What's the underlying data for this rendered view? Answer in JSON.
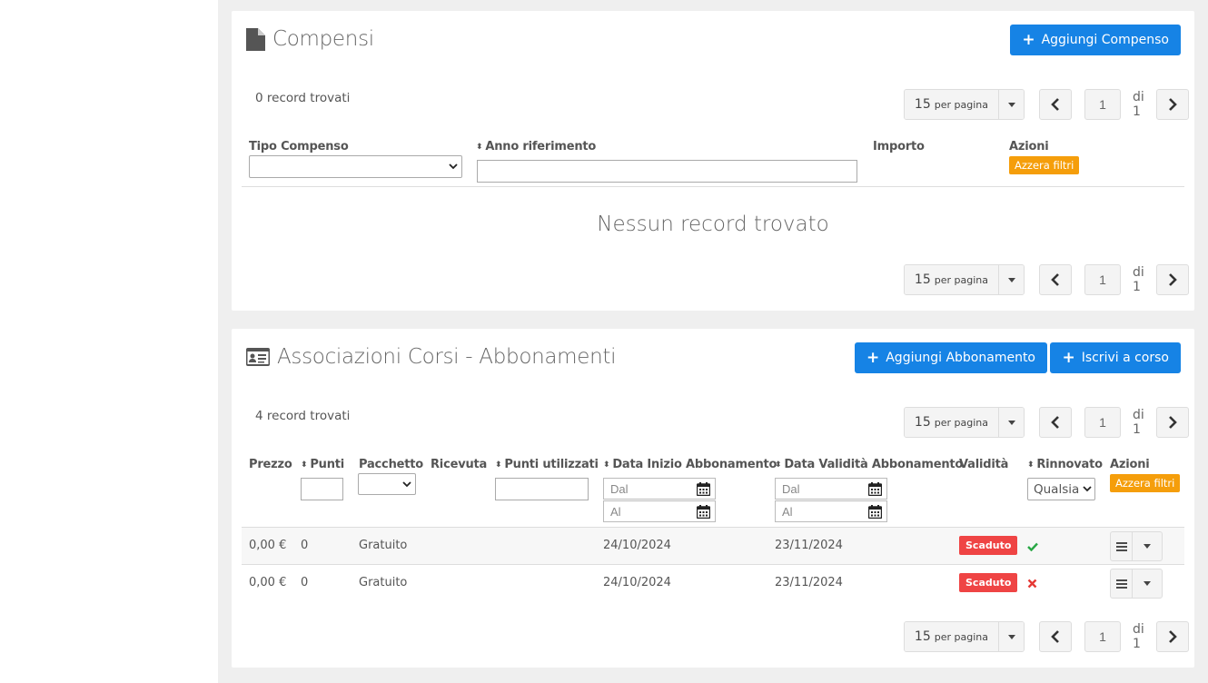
{
  "compensi": {
    "title": "Compensi",
    "add_button": "Aggiungi Compenso",
    "record_count": "0 record trovati",
    "pager": {
      "per_page": "15",
      "per_page_suffix": "per pagina",
      "page": "1",
      "of": "di 1"
    },
    "columns": {
      "tipo": "Tipo Compenso",
      "anno": "Anno riferimento",
      "importo": "Importo",
      "azioni": "Azioni"
    },
    "reset_filters": "Azzera filtri",
    "empty_message": "Nessun record trovato"
  },
  "abbonamenti": {
    "title": "Associazioni Corsi - Abbonamenti",
    "add_button": "Aggiungi Abbonamento",
    "enroll_button": "Iscrivi a corso",
    "record_count": "4 record trovati",
    "pager": {
      "per_page": "15",
      "per_page_suffix": "per pagina",
      "page": "1",
      "of": "di 1"
    },
    "columns": {
      "prezzo": "Prezzo",
      "punti": "Punti",
      "pacchetto": "Pacchetto",
      "ricevuta": "Ricevuta",
      "punti_utilizzati": "Punti utilizzati",
      "data_inizio": "Data Inizio Abbonamento",
      "data_validita": "Data Validità Abbonamento",
      "validita": "Validità",
      "rinnovato": "Rinnovato",
      "azioni": "Azioni"
    },
    "filters": {
      "dal": "Dal",
      "al": "Al",
      "rinnovato_value": "Qualsiasi"
    },
    "reset_filters": "Azzera filtri",
    "rows": [
      {
        "prezzo": "0,00 €",
        "punti": "0",
        "pacchetto": "Gratuito",
        "data_inizio": "24/10/2024",
        "data_validita": "23/11/2024",
        "validita": "Scaduto",
        "rinnovato": "check-icon"
      },
      {
        "prezzo": "0,00 €",
        "punti": "0",
        "pacchetto": "Gratuito",
        "data_inizio": "24/10/2024",
        "data_validita": "23/11/2024",
        "validita": "Scaduto",
        "rinnovato": "cross-icon"
      }
    ]
  },
  "colors": {
    "primary": "#1683e5",
    "warning": "#f59e0b",
    "danger": "#ef4444",
    "success": "#28a745",
    "cross": "#e53935"
  }
}
